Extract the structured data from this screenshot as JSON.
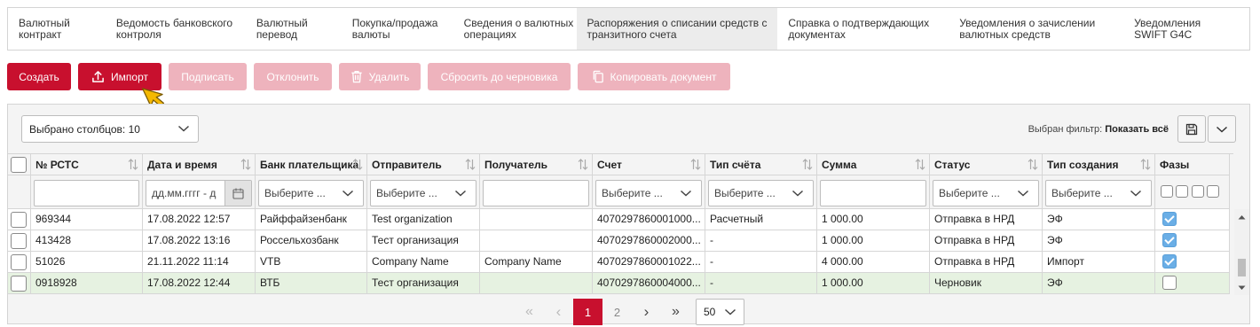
{
  "tabs": [
    {
      "label": "Валютный\nконтракт"
    },
    {
      "label": "Ведомость банковского\nконтроля"
    },
    {
      "label": "Валютный\nперевод"
    },
    {
      "label": "Покупка/продажа\nвалюты"
    },
    {
      "label": "Сведения о валютных\nоперациях"
    },
    {
      "label": "Распоряжения о списании средств с\nтранзитного счета"
    },
    {
      "label": "Справка о подтверждающих\nдокументах"
    },
    {
      "label": "Уведомления о зачислении\nвалютных средств"
    },
    {
      "label": "Уведомления\nSWIFT G4C"
    }
  ],
  "toolbar": {
    "create": "Создать",
    "import": "Импорт",
    "sign": "Подписать",
    "reject": "Отклонить",
    "delete": "Удалить",
    "reset_draft": "Сбросить до черновика",
    "copy": "Копировать документ"
  },
  "grid": {
    "column_selector": "Выбрано столбцов: 10",
    "filter_label": "Выбран фильтр:",
    "filter_value": "Показать всё",
    "columns": [
      "№ РСТС",
      "Дата и время",
      "Банк плательщика",
      "Отправитель",
      "Получатель",
      "Счет",
      "Тип счёта",
      "Сумма",
      "Статус",
      "Тип создания",
      "Фазы"
    ],
    "filters": {
      "date_placeholder": "дд.мм.гггг - д",
      "select_placeholder": "Выберите ..."
    },
    "rows": [
      {
        "num": "969344",
        "date": "17.08.2022 12:57",
        "bank": "Райффайзенбанк",
        "sender": "Test organization",
        "receiver": "",
        "account": "4070297860001000...",
        "acc_type": "Расчетный",
        "amount": "1 000.00",
        "status": "Отправка в НРД",
        "creation": "ЭФ",
        "phase": true
      },
      {
        "num": "413428",
        "date": "17.08.2022 13:16",
        "bank": "Россельхозбанк",
        "sender": "Тест организация",
        "receiver": "",
        "account": "4070297860002000...",
        "acc_type": "-",
        "amount": "1 000.00",
        "status": "Отправка в НРД",
        "creation": "ЭФ",
        "phase": true
      },
      {
        "num": "51026",
        "date": "21.11.2022 11:14",
        "bank": "VTB",
        "sender": "Company Name",
        "receiver": "Company Name",
        "account": "4070297860001022...",
        "acc_type": "-",
        "amount": "4 000.00",
        "status": "Отправка в НРД",
        "creation": "Импорт",
        "phase": true
      },
      {
        "num": "0918928",
        "date": "17.08.2022 12:44",
        "bank": "ВТБ",
        "sender": "Тест организация",
        "receiver": "",
        "account": "4070297860004000...",
        "acc_type": "-",
        "amount": "1 000.00",
        "status": "Черновик",
        "creation": "ЭФ",
        "phase": false,
        "highlight": true
      }
    ]
  },
  "pager": {
    "first": "«",
    "prev": "‹",
    "pages": [
      "1",
      "2"
    ],
    "next": "›",
    "last": "»",
    "per_page": "50"
  },
  "colors": {
    "brand": "#c8102e",
    "brand_disabled": "#eeb3bd",
    "row_highlight": "#e6f2e1",
    "check_blue": "#6aaee6",
    "cursor": "#f5b800"
  },
  "icons": {
    "import": "upload-icon",
    "delete": "trash-icon",
    "copy": "copy-icon",
    "save": "floppy-disk-icon",
    "dropdown": "chevron-down-icon",
    "date": "calendar-icon",
    "sort": "sort-arrows-icon",
    "cursor": "pointer-cursor-icon"
  }
}
